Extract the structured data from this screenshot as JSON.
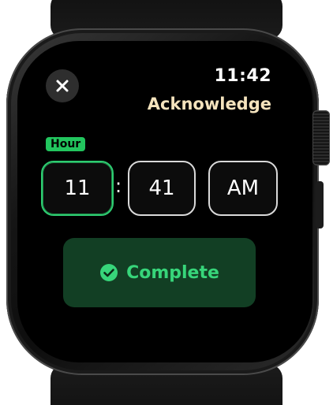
{
  "status": {
    "time": "11:42"
  },
  "header": {
    "title": "Acknowledge",
    "close_icon": "close-icon"
  },
  "time_picker": {
    "active_field_label": "Hour",
    "hour": "11",
    "separator": ":",
    "minute": "41",
    "period": "AM"
  },
  "actions": {
    "complete_label": "Complete",
    "complete_icon": "checkmark-circle-icon"
  },
  "colors": {
    "accent_green": "#2ecc71",
    "title_cream": "#f4e3bd",
    "button_bg": "#123f24"
  }
}
